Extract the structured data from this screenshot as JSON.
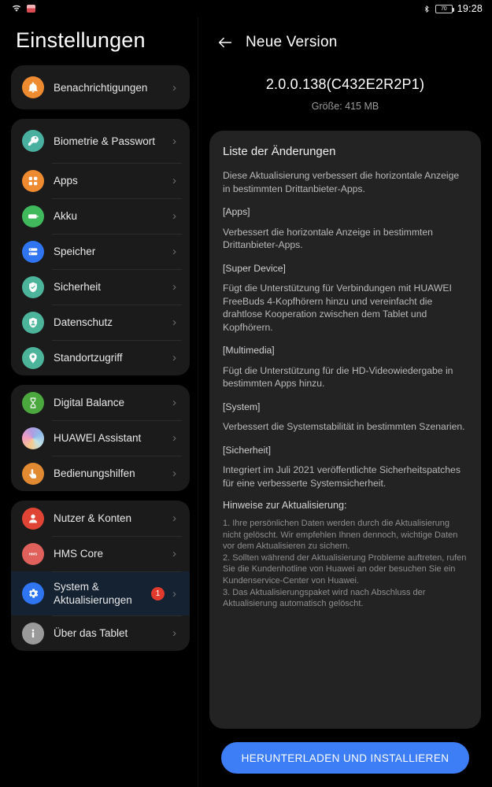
{
  "statusbar": {
    "wifi_icon": "wifi-icon",
    "recording_icon": "screen-record-icon",
    "bluetooth_icon": "bluetooth-icon",
    "battery_level": "70",
    "time": "19:28"
  },
  "sidebar": {
    "title": "Einstellungen",
    "groups": [
      {
        "items": [
          {
            "label": "Benachrichtigungen",
            "icon": "bell-icon",
            "color": "#ee8b30",
            "tall": true,
            "selected": false,
            "badge": ""
          }
        ]
      },
      {
        "items": [
          {
            "label": "Biometrie & Passwort",
            "icon": "key-icon",
            "color": "#49b0a0",
            "tall": true,
            "selected": false,
            "badge": ""
          },
          {
            "label": "Apps",
            "icon": "apps-grid-icon",
            "color": "#ee8b30",
            "tall": false,
            "selected": false,
            "badge": ""
          },
          {
            "label": "Akku",
            "icon": "battery-icon",
            "color": "#3fb95c",
            "tall": false,
            "selected": false,
            "badge": ""
          },
          {
            "label": "Speicher",
            "icon": "storage-icon",
            "color": "#2f74f0",
            "tall": false,
            "selected": false,
            "badge": ""
          },
          {
            "label": "Sicherheit",
            "icon": "shield-check-icon",
            "color": "#4cb49a",
            "tall": false,
            "selected": false,
            "badge": ""
          },
          {
            "label": "Datenschutz",
            "icon": "privacy-shield-icon",
            "color": "#4cb49a",
            "tall": false,
            "selected": false,
            "badge": ""
          },
          {
            "label": "Standortzugriff",
            "icon": "location-pin-icon",
            "color": "#4cb49a",
            "tall": false,
            "selected": false,
            "badge": ""
          }
        ]
      },
      {
        "items": [
          {
            "label": "Digital Balance",
            "icon": "hourglass-icon",
            "color": "#4aa83e",
            "tall": false,
            "selected": false,
            "badge": ""
          },
          {
            "label": "HUAWEI Assistant",
            "icon": "assistant-gradient-icon",
            "color": "#b9a6e0",
            "tall": false,
            "selected": false,
            "badge": ""
          },
          {
            "label": "Bedienungshilfen",
            "icon": "accessibility-touch-icon",
            "color": "#e28a32",
            "tall": false,
            "selected": false,
            "badge": ""
          }
        ]
      },
      {
        "items": [
          {
            "label": "Nutzer & Konten",
            "icon": "user-account-icon",
            "color": "#e04434",
            "tall": false,
            "selected": false,
            "badge": ""
          },
          {
            "label": "HMS Core",
            "icon": "hms-core-icon",
            "color": "#e0615c",
            "tall": false,
            "selected": false,
            "badge": ""
          },
          {
            "label": "System & Aktualisierungen",
            "icon": "gear-icon",
            "color": "#2f74f0",
            "tall": true,
            "selected": true,
            "badge": "1"
          },
          {
            "label": "Über das Tablet",
            "icon": "info-icon",
            "color": "#9a9a9a",
            "tall": false,
            "selected": false,
            "badge": ""
          }
        ]
      }
    ]
  },
  "detail": {
    "back_icon": "back-arrow-icon",
    "title": "Neue Version",
    "version": "2.0.0.138(C432E2R2P1)",
    "size": "Größe: 415 MB",
    "changelog_title": "Liste der Änderungen",
    "summary": "Diese Aktualisierung verbessert die horizontale Anzeige in bestimmten Drittanbieter-Apps.",
    "sections": [
      {
        "head": "[Apps]",
        "text": "Verbessert die horizontale Anzeige in bestimmten Drittanbieter-Apps."
      },
      {
        "head": "[Super Device]",
        "text": "Fügt die Unterstützung für Verbindungen mit HUAWEI FreeBuds 4-Kopfhörern hinzu und vereinfacht die drahtlose Kooperation zwischen dem Tablet und Kopfhörern."
      },
      {
        "head": "[Multimedia]",
        "text": "Fügt die Unterstützung für die HD-Videowiedergabe in bestimmten Apps hinzu."
      },
      {
        "head": "[System]",
        "text": "Verbessert die Systemstabilität in bestimmten Szenarien."
      },
      {
        "head": "[Sicherheit]",
        "text": "Integriert im Juli 2021 veröffentlichte Sicherheitspatches für eine verbesserte Systemsicherheit."
      }
    ],
    "notes_title": "Hinweise zur Aktualisierung:",
    "notes": "1. Ihre persönlichen Daten werden durch die Aktualisierung nicht gelöscht. Wir empfehlen Ihnen dennoch, wichtige Daten vor dem Aktualisieren zu sichern.\n2. Sollten während der Aktualisierung Probleme auftreten, rufen Sie die Kundenhotline von Huawei an oder besuchen Sie ein Kundenservice-Center von Huawei.\n3. Das Aktualisierungspaket wird nach Abschluss der Aktualisierung automatisch gelöscht.",
    "download_label": "HERUNTERLADEN UND INSTALLIEREN"
  },
  "colors": {
    "accent_blue": "#3d7df6",
    "badge_red": "#e23b2e",
    "card_bg": "#232324",
    "group_bg": "#1b1b1c",
    "selected_row": "#152232"
  }
}
